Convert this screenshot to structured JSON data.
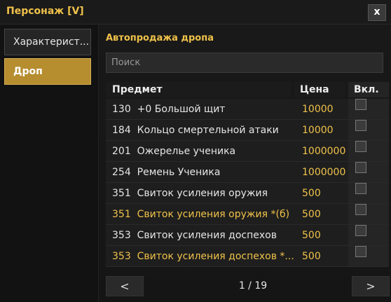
{
  "window": {
    "title": "Персонаж  [V]",
    "close_label": "x"
  },
  "sidebar": {
    "items": [
      {
        "label": "Характерист..."
      },
      {
        "label": "Дроп"
      }
    ]
  },
  "main": {
    "section_title": "Автопродажа дропа",
    "search": {
      "placeholder": "Поиск",
      "value": ""
    },
    "columns": {
      "item": "Предмет",
      "price": "Цена",
      "enabled": "Вкл."
    },
    "rows": [
      {
        "id": "130",
        "name": "+0 Большой щит",
        "price": "10000",
        "enabled": false,
        "highlight": false
      },
      {
        "id": "184",
        "name": "Кольцо смертельной атаки",
        "price": "10000",
        "enabled": false,
        "highlight": false
      },
      {
        "id": "201",
        "name": "Ожерелье ученика",
        "price": "1000000",
        "enabled": false,
        "highlight": false
      },
      {
        "id": "254",
        "name": "Ремень Ученика",
        "price": "1000000",
        "enabled": false,
        "highlight": false
      },
      {
        "id": "351",
        "name": "Свиток усиления оружия",
        "price": "500",
        "enabled": false,
        "highlight": false
      },
      {
        "id": "351",
        "name": "Свиток усиления оружия *(б)",
        "price": "500",
        "enabled": false,
        "highlight": true
      },
      {
        "id": "353",
        "name": "Свиток усиления доспехов",
        "price": "500",
        "enabled": false,
        "highlight": false
      },
      {
        "id": "353",
        "name": "Свиток усиления доспехов *...",
        "price": "500",
        "enabled": false,
        "highlight": true
      }
    ],
    "pager": {
      "prev_label": "<",
      "next_label": ">",
      "page_text": "1 / 19"
    }
  },
  "colors": {
    "accent": "#f0c24a",
    "active_button": "#b68d2f"
  }
}
